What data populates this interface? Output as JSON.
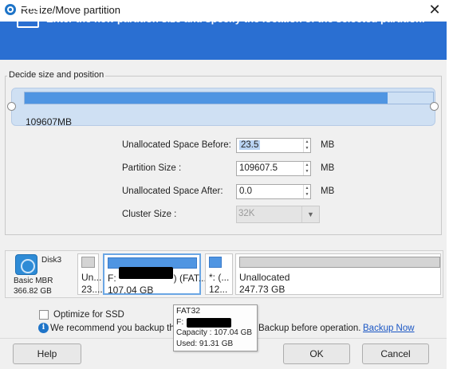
{
  "window": {
    "title": "Resize/Move partition",
    "close_label": "✕"
  },
  "banner": {
    "text": "Enter the new partition size and specify the location of the selected partition.",
    "icon": "resize-arrows-icon",
    "color": "#2a6fd2"
  },
  "group": {
    "title": "Decide size and position"
  },
  "slider": {
    "size_label": "109607MB",
    "fill_fraction": 0.885
  },
  "form": {
    "before_label": "Unallocated Space Before:",
    "before_value": "23.5",
    "size_label": "Partition Size :",
    "size_value": "109607.5",
    "after_label": "Unallocated Space After:",
    "after_value": "0.0",
    "cluster_label": "Cluster Size :",
    "cluster_value": "32K",
    "unit": "MB"
  },
  "disk": {
    "name": "Disk3",
    "type": "Basic MBR",
    "size": "366.82 GB",
    "partitions": [
      {
        "name": "Un...",
        "size": "23...."
      },
      {
        "name": "F:",
        "name_suffix": ") (FAT...",
        "size": "107.04 GB"
      },
      {
        "name": "*: (...",
        "size": "12..."
      },
      {
        "name": "Unallocated",
        "size": "247.73 GB"
      }
    ]
  },
  "options": {
    "ssd_label": "Optimize for SSD",
    "ssd_checked": false,
    "recommend_prefix": "We recommend you backup the",
    "recommend_suffix": "Backup before operation.",
    "backup_link": "Backup Now"
  },
  "tooltip": {
    "fs": "FAT32",
    "drive": "F:",
    "capacity": "Capacity : 107.04 GB",
    "used": "Used: 91.31 GB"
  },
  "buttons": {
    "help": "Help",
    "ok": "OK",
    "cancel": "Cancel"
  }
}
